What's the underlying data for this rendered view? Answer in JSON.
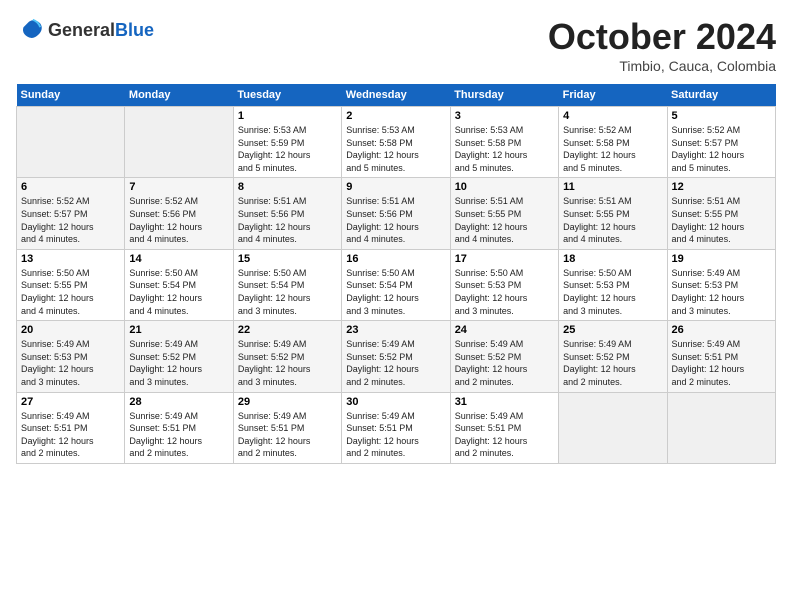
{
  "header": {
    "logo_general": "General",
    "logo_blue": "Blue",
    "month": "October 2024",
    "location": "Timbio, Cauca, Colombia"
  },
  "weekdays": [
    "Sunday",
    "Monday",
    "Tuesday",
    "Wednesday",
    "Thursday",
    "Friday",
    "Saturday"
  ],
  "weeks": [
    [
      {
        "day": "",
        "info": ""
      },
      {
        "day": "",
        "info": ""
      },
      {
        "day": "1",
        "info": "Sunrise: 5:53 AM\nSunset: 5:59 PM\nDaylight: 12 hours\nand 5 minutes."
      },
      {
        "day": "2",
        "info": "Sunrise: 5:53 AM\nSunset: 5:58 PM\nDaylight: 12 hours\nand 5 minutes."
      },
      {
        "day": "3",
        "info": "Sunrise: 5:53 AM\nSunset: 5:58 PM\nDaylight: 12 hours\nand 5 minutes."
      },
      {
        "day": "4",
        "info": "Sunrise: 5:52 AM\nSunset: 5:58 PM\nDaylight: 12 hours\nand 5 minutes."
      },
      {
        "day": "5",
        "info": "Sunrise: 5:52 AM\nSunset: 5:57 PM\nDaylight: 12 hours\nand 5 minutes."
      }
    ],
    [
      {
        "day": "6",
        "info": "Sunrise: 5:52 AM\nSunset: 5:57 PM\nDaylight: 12 hours\nand 4 minutes."
      },
      {
        "day": "7",
        "info": "Sunrise: 5:52 AM\nSunset: 5:56 PM\nDaylight: 12 hours\nand 4 minutes."
      },
      {
        "day": "8",
        "info": "Sunrise: 5:51 AM\nSunset: 5:56 PM\nDaylight: 12 hours\nand 4 minutes."
      },
      {
        "day": "9",
        "info": "Sunrise: 5:51 AM\nSunset: 5:56 PM\nDaylight: 12 hours\nand 4 minutes."
      },
      {
        "day": "10",
        "info": "Sunrise: 5:51 AM\nSunset: 5:55 PM\nDaylight: 12 hours\nand 4 minutes."
      },
      {
        "day": "11",
        "info": "Sunrise: 5:51 AM\nSunset: 5:55 PM\nDaylight: 12 hours\nand 4 minutes."
      },
      {
        "day": "12",
        "info": "Sunrise: 5:51 AM\nSunset: 5:55 PM\nDaylight: 12 hours\nand 4 minutes."
      }
    ],
    [
      {
        "day": "13",
        "info": "Sunrise: 5:50 AM\nSunset: 5:55 PM\nDaylight: 12 hours\nand 4 minutes."
      },
      {
        "day": "14",
        "info": "Sunrise: 5:50 AM\nSunset: 5:54 PM\nDaylight: 12 hours\nand 4 minutes."
      },
      {
        "day": "15",
        "info": "Sunrise: 5:50 AM\nSunset: 5:54 PM\nDaylight: 12 hours\nand 3 minutes."
      },
      {
        "day": "16",
        "info": "Sunrise: 5:50 AM\nSunset: 5:54 PM\nDaylight: 12 hours\nand 3 minutes."
      },
      {
        "day": "17",
        "info": "Sunrise: 5:50 AM\nSunset: 5:53 PM\nDaylight: 12 hours\nand 3 minutes."
      },
      {
        "day": "18",
        "info": "Sunrise: 5:50 AM\nSunset: 5:53 PM\nDaylight: 12 hours\nand 3 minutes."
      },
      {
        "day": "19",
        "info": "Sunrise: 5:49 AM\nSunset: 5:53 PM\nDaylight: 12 hours\nand 3 minutes."
      }
    ],
    [
      {
        "day": "20",
        "info": "Sunrise: 5:49 AM\nSunset: 5:53 PM\nDaylight: 12 hours\nand 3 minutes."
      },
      {
        "day": "21",
        "info": "Sunrise: 5:49 AM\nSunset: 5:52 PM\nDaylight: 12 hours\nand 3 minutes."
      },
      {
        "day": "22",
        "info": "Sunrise: 5:49 AM\nSunset: 5:52 PM\nDaylight: 12 hours\nand 3 minutes."
      },
      {
        "day": "23",
        "info": "Sunrise: 5:49 AM\nSunset: 5:52 PM\nDaylight: 12 hours\nand 2 minutes."
      },
      {
        "day": "24",
        "info": "Sunrise: 5:49 AM\nSunset: 5:52 PM\nDaylight: 12 hours\nand 2 minutes."
      },
      {
        "day": "25",
        "info": "Sunrise: 5:49 AM\nSunset: 5:52 PM\nDaylight: 12 hours\nand 2 minutes."
      },
      {
        "day": "26",
        "info": "Sunrise: 5:49 AM\nSunset: 5:51 PM\nDaylight: 12 hours\nand 2 minutes."
      }
    ],
    [
      {
        "day": "27",
        "info": "Sunrise: 5:49 AM\nSunset: 5:51 PM\nDaylight: 12 hours\nand 2 minutes."
      },
      {
        "day": "28",
        "info": "Sunrise: 5:49 AM\nSunset: 5:51 PM\nDaylight: 12 hours\nand 2 minutes."
      },
      {
        "day": "29",
        "info": "Sunrise: 5:49 AM\nSunset: 5:51 PM\nDaylight: 12 hours\nand 2 minutes."
      },
      {
        "day": "30",
        "info": "Sunrise: 5:49 AM\nSunset: 5:51 PM\nDaylight: 12 hours\nand 2 minutes."
      },
      {
        "day": "31",
        "info": "Sunrise: 5:49 AM\nSunset: 5:51 PM\nDaylight: 12 hours\nand 2 minutes."
      },
      {
        "day": "",
        "info": ""
      },
      {
        "day": "",
        "info": ""
      }
    ]
  ]
}
